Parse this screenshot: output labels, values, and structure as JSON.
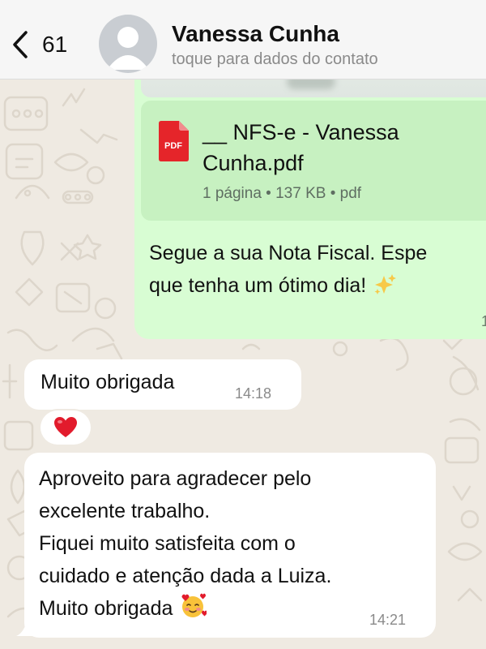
{
  "header": {
    "back_count": "61",
    "contact_name": "Vanessa Cunha",
    "contact_subtitle": "toque para dados do contato"
  },
  "messages": {
    "outgoing": {
      "document": {
        "icon_label": "PDF",
        "name_line1": "__ NFS-e - Vanessa",
        "name_line2": "Cunha.pdf",
        "meta": "1 página • 137 KB • pdf"
      },
      "text_line1": "Segue a sua Nota Fiscal. Espe",
      "text_line2": "que tenha um ótimo dia!",
      "time_visible": "1"
    },
    "incoming_1": {
      "text": "Muito obrigada",
      "time": "14:18",
      "reaction": "heart"
    },
    "incoming_2": {
      "lines": [
        "Aproveito para agradecer pelo",
        "excelente trabalho.",
        "Fiquei muito satisfeita com o",
        "cuidado e atenção dada a Luiza.",
        "Muito obrigada"
      ],
      "time": "14:21"
    }
  },
  "colors": {
    "chat_background": "#efeae2",
    "outgoing_bubble": "#d8fdd3",
    "incoming_bubble": "#ffffff",
    "pdf_red": "#e5252a",
    "header_bg": "#f6f6f6"
  },
  "icons": [
    "chevron-left-icon",
    "avatar-placeholder-icon",
    "pdf-file-icon",
    "sparkles-emoji",
    "red-heart-emoji",
    "smiling-face-with-hearts-emoji"
  ]
}
